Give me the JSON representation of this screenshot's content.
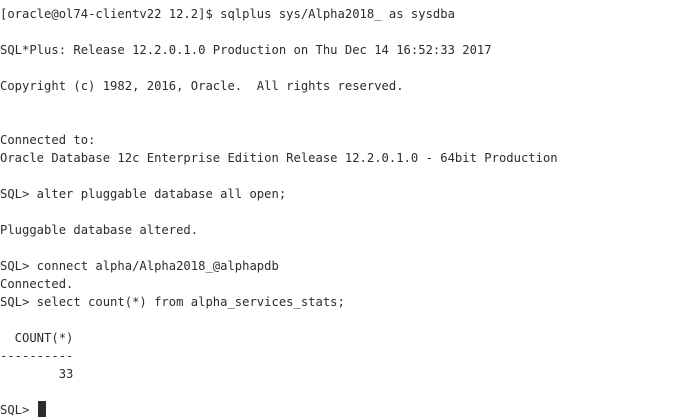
{
  "terminal": {
    "clipped_top_text": "                                                 -",
    "lines": [
      "[oracle@ol74-clientv22 12.2]$ sqlplus sys/Alpha2018_ as sysdba",
      "SQL*Plus: Release 12.2.0.1.0 Production on Thu Dec 14 16:52:33 2017",
      "Copyright (c) 1982, 2016, Oracle.  All rights reserved.",
      "Connected to:",
      "Oracle Database 12c Enterprise Edition Release 12.2.0.1.0 - 64bit Production",
      "SQL> alter pluggable database all open;",
      "Pluggable database altered.",
      "SQL> connect alpha/Alpha2018_@alphapdb",
      "Connected.",
      "SQL> select count(*) from alpha_services_stats;",
      "  COUNT(*)",
      "----------",
      "        33"
    ],
    "prompt": "SQL> "
  },
  "colors": {
    "background": "#ffffff",
    "text": "#2c2c2c",
    "cursor": "#2c2c2c"
  }
}
